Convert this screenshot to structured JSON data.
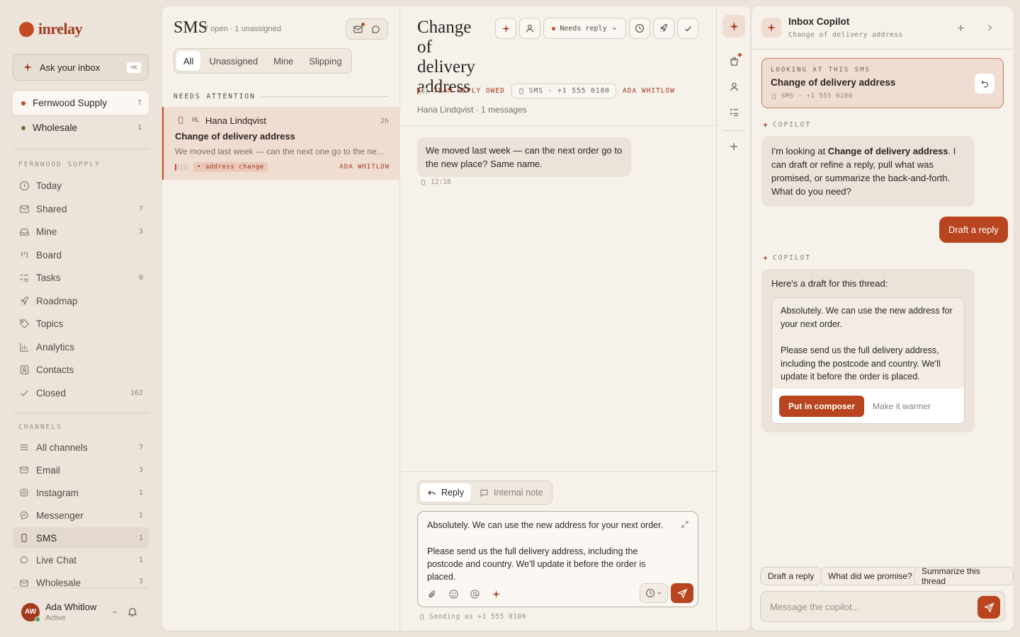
{
  "app": {
    "logo_text": "inrelay"
  },
  "sidebar": {
    "ask_label": "Ask your inbox",
    "ask_shortcut": "⌘K",
    "workspaces": [
      {
        "label": "Fernwood Supply",
        "count": "7",
        "color": "#c44a23"
      },
      {
        "label": "Wholesale",
        "count": "1",
        "color": "#7a6a3a"
      }
    ],
    "section_label": "FERNWOOD SUPPLY",
    "items": [
      {
        "label": "Today",
        "count": "",
        "icon": "clock-icon"
      },
      {
        "label": "Shared",
        "count": "7",
        "icon": "inbox-icon"
      },
      {
        "label": "Mine",
        "count": "3",
        "icon": "tray-icon"
      },
      {
        "label": "Board",
        "count": "",
        "icon": "board-icon"
      },
      {
        "label": "Tasks",
        "count": "0",
        "icon": "tasks-icon"
      },
      {
        "label": "Roadmap",
        "count": "",
        "icon": "rocket-icon"
      },
      {
        "label": "Topics",
        "count": "",
        "icon": "tag-icon"
      },
      {
        "label": "Analytics",
        "count": "",
        "icon": "chart-icon"
      },
      {
        "label": "Contacts",
        "count": "",
        "icon": "contact-icon"
      },
      {
        "label": "Closed",
        "count": "162",
        "icon": "check-icon"
      }
    ],
    "channels_label": "CHANNELS",
    "channels": [
      {
        "label": "All channels",
        "count": "7",
        "icon": "list-icon"
      },
      {
        "label": "Email",
        "count": "3",
        "icon": "mail-icon"
      },
      {
        "label": "Instagram",
        "count": "1",
        "icon": "instagram-icon"
      },
      {
        "label": "Messenger",
        "count": "1",
        "icon": "messenger-icon"
      },
      {
        "label": "SMS",
        "count": "1",
        "icon": "phone-icon"
      },
      {
        "label": "Live Chat",
        "count": "1",
        "icon": "chat-icon"
      },
      {
        "label": "Wholesale",
        "count": "3",
        "icon": "mail-icon"
      }
    ],
    "user": {
      "initials": "AW",
      "name": "Ada Whitlow",
      "status": "Active"
    }
  },
  "list": {
    "title": "SMS",
    "subtitle": "7 open · 1 unassigned",
    "filters": [
      "All",
      "Unassigned",
      "Mine",
      "Slipping"
    ],
    "active_filter": "All",
    "section": "NEEDS ATTENTION",
    "item": {
      "initials": "HL",
      "name": "Hana Lindqvist",
      "time": "2h",
      "subject": "Change of delivery address",
      "preview": "We moved last week — can the next one go to the new place? Same name.",
      "tag": "• address change",
      "assignee": "ADA WHITLOW"
    }
  },
  "conversation": {
    "title": "Change of delivery address",
    "status": "Needs reply",
    "flag": "TEAM REPLY OWED",
    "channel_chip": "SMS · +1 555 0100",
    "assignee": "ADA WHITLOW",
    "subline": "Hana Lindqvist · 1 messages",
    "message": {
      "text": "We moved last week — can the next order go to the new place? Same name.",
      "time": "12:18"
    },
    "reply_tab": "Reply",
    "note_tab": "Internal note",
    "composer_p1": "Absolutely. We can use the new address for your next order.",
    "composer_p2": "Please send us the full delivery address, including the postcode and country. We'll update it before the order is placed.",
    "sending_as": "Sending as +1 555 0100"
  },
  "copilot": {
    "title": "Inbox Copilot",
    "subtitle": "Change of delivery address",
    "context_label": "LOOKING AT THIS SMS",
    "context_title": "Change of delivery address",
    "context_meta": "SMS · +1 555 0100",
    "label": "COPILOT",
    "msg1_pre": "I'm looking at ",
    "msg1_bold": "Change of delivery address",
    "msg1_post": ". I can draft or refine a reply, pull what was promised, or summarize the back-and-forth. What do you need?",
    "user_msg": "Draft a reply",
    "draft_intro": "Here's a draft for this thread:",
    "draft_p1": "Absolutely. We can use the new address for your next order.",
    "draft_p2": "Please send us the full delivery address, including the postcode and country. We'll update it before the order is placed.",
    "put_button": "Put in composer",
    "warmer_button": "Make it warmer",
    "suggestions": [
      "Draft a reply",
      "What did we promise?",
      "Summarize this thread"
    ],
    "input_placeholder": "Message the copilot..."
  }
}
